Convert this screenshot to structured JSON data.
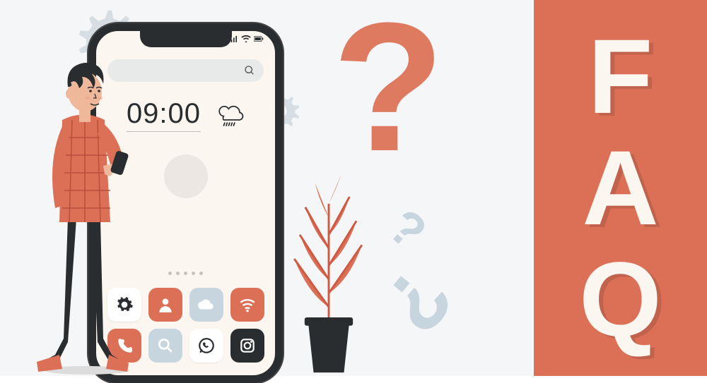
{
  "faq": {
    "letter1": "F",
    "letter2": "A",
    "letter3": "Q"
  },
  "questionMarks": {
    "big": "?",
    "small1": "?",
    "small2": "?"
  },
  "phone": {
    "time": "09:00",
    "search": {
      "placeholder": ""
    },
    "apps": {
      "settings": "settings",
      "contacts": "contacts",
      "cloud": "cloud",
      "wifi": "wifi",
      "phone": "phone",
      "search": "search",
      "whatsapp": "whatsapp",
      "instagram": "instagram"
    }
  },
  "colors": {
    "coral": "#dc7057",
    "paleBlue": "#c7d5df",
    "dark": "#2a2d2f",
    "cream": "#fcf6f0"
  }
}
